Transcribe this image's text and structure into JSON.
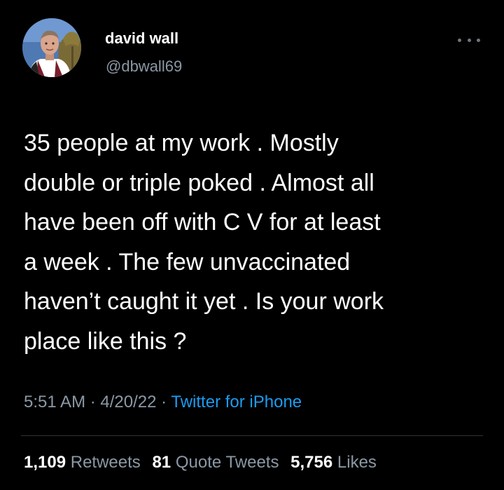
{
  "author": {
    "display_name": "david wall",
    "handle": "@dbwall69",
    "avatar_icon": "user-avatar-photo"
  },
  "tweet": {
    "lines": [
      "35 people at my work . Mostly",
      "double or triple poked . Almost all",
      "have been off with C V for at least",
      "a week . The few unvaccinated",
      "haven’t caught it yet . Is your work",
      "place like this ?"
    ]
  },
  "meta": {
    "time": "5:51 AM",
    "separator": "·",
    "date": "4/20/22",
    "source": "Twitter for iPhone"
  },
  "stats": {
    "retweets_count": "1,109",
    "retweets_label": "Retweets",
    "quotes_count": "81",
    "quotes_label": "Quote Tweets",
    "likes_count": "5,756",
    "likes_label": "Likes"
  },
  "colors": {
    "background": "#000000",
    "text": "#ffffff",
    "secondary": "#8b98a5",
    "link": "#1d9bf0",
    "divider": "#2f3336"
  },
  "icons": {
    "more": "more-options-icon"
  }
}
